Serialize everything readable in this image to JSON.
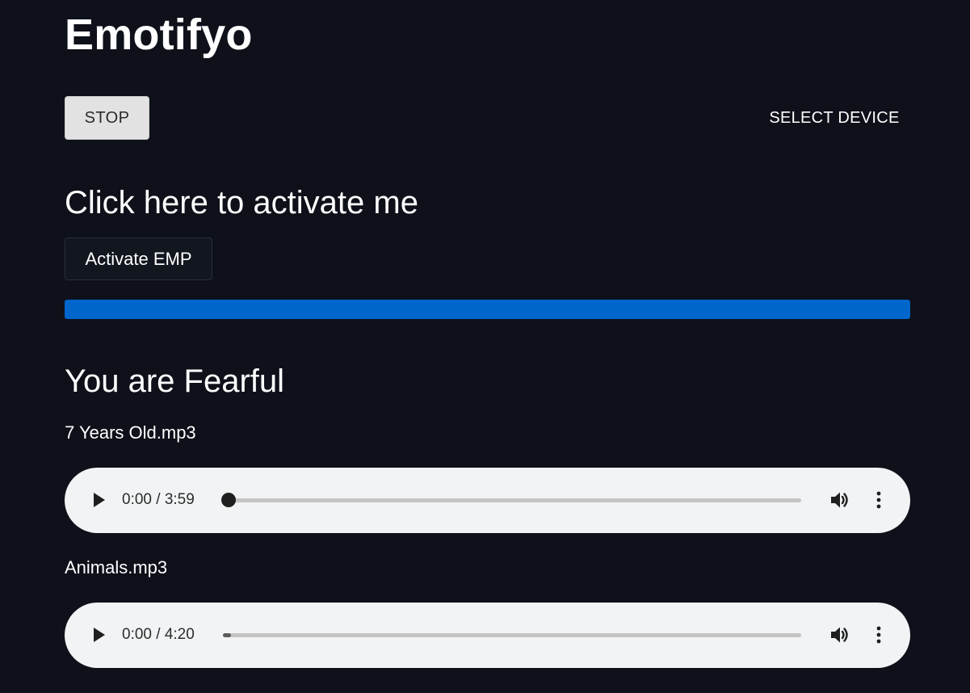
{
  "header": {
    "app_title": "Emotifyo"
  },
  "toolbar": {
    "stop_label": "STOP",
    "select_device_label": "SELECT DEVICE"
  },
  "activation": {
    "heading": "Click here to activate me",
    "button_label": "Activate EMP",
    "progress_percent": 100,
    "progress_color": "#0066cc"
  },
  "result": {
    "heading": "You are Fearful"
  },
  "tracks": [
    {
      "title": "7 Years Old.mp3",
      "time_display": "0:00 / 3:59",
      "played_fraction": 0.0,
      "buffered_fraction": 0.0,
      "show_thumb": true
    },
    {
      "title": "Animals.mp3",
      "time_display": "0:00 / 4:20",
      "played_fraction": 0.0,
      "buffered_fraction": 0.014,
      "show_thumb": false
    }
  ],
  "colors": {
    "background": "#0e111a",
    "player_background": "#f1f3f4",
    "accent": "#0066cc"
  },
  "icons": {
    "play": "play-icon",
    "volume": "volume-icon",
    "more": "more-vertical-icon"
  }
}
